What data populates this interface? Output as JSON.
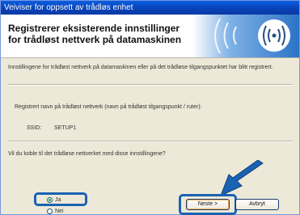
{
  "window": {
    "title": "Veiviser for oppsett av trådløs enhet"
  },
  "banner": {
    "title_line1": "Registrerer eksisterende innstillinger",
    "title_line2": "for trådløst nettverk på datamaskinen",
    "icon": "wifi-signal-icon"
  },
  "content": {
    "intro": "Innstillingene for trådløst nettverk på datamaskinen eller på det trådløse tilgangspunktet har blitt registrert.",
    "network_name_label": "Registrert navn på trådløst nettverk (navn på trådløst tilgangspunkt / ruter):",
    "ssid_label": "SSID:",
    "ssid_value": "SETUP1",
    "question": "Vil du koble til det trådløse nettverket med disse innstillingene?",
    "options": [
      {
        "label": "Ja",
        "selected": true
      },
      {
        "label": "Nei",
        "selected": false
      }
    ]
  },
  "buttons": {
    "next": "Neste >",
    "cancel": "Avbryt"
  },
  "colors": {
    "highlight": "#1a62b3",
    "titlebar": "#0842b8"
  }
}
